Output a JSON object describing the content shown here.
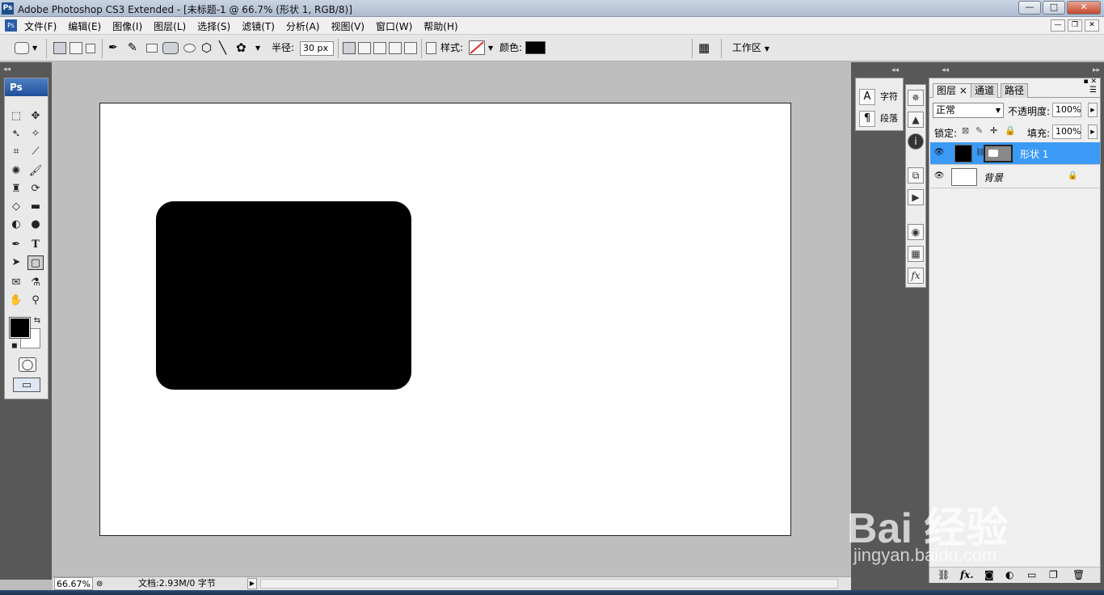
{
  "window": {
    "title": "Adobe Photoshop CS3 Extended - [未标题-1 @ 66.7% (形状 1, RGB/8)]",
    "app_icon_text": "Ps",
    "minimize": "—",
    "maximize": "□",
    "close": "✕"
  },
  "menu": {
    "items": [
      "文件(F)",
      "编辑(E)",
      "图像(I)",
      "图层(L)",
      "选择(S)",
      "滤镜(T)",
      "分析(A)",
      "视图(V)",
      "窗口(W)",
      "帮助(H)"
    ],
    "doc_minimize": "—",
    "doc_restore": "❐",
    "doc_close": "✕"
  },
  "options": {
    "radius_label": "半径:",
    "radius_value": "30 px",
    "style_label": "样式:",
    "color_label": "颜色:",
    "color_value": "#000000",
    "workspace_label": "工作区",
    "workspace_arrow": "▼"
  },
  "toolbox": {
    "header": "Ps",
    "foreground_color": "#000000",
    "background_color": "#ffffff"
  },
  "status": {
    "zoom": "66.67%",
    "doc_info": "文档:2.93M/0 字节",
    "arrow": "▶"
  },
  "mini_panel": {
    "char_label": "字符",
    "para_label": "段落",
    "char_icon": "A",
    "para_icon": "¶"
  },
  "layers_panel": {
    "tabs": [
      "图层",
      "通道",
      "路径"
    ],
    "tab_close": "×",
    "blend_mode": "正常",
    "opacity_label": "不透明度:",
    "opacity_value": "100%",
    "lock_label": "锁定:",
    "fill_label": "填充:",
    "fill_value": "100%",
    "layers": [
      {
        "name": "形状 1",
        "selected": true
      },
      {
        "name": "背景",
        "selected": false
      }
    ],
    "footer_fx": "fx."
  },
  "watermark": {
    "brand": "Bai 经验",
    "url": "jingyan.baidu.com"
  },
  "colors": {
    "selection_blue": "#3a9af5",
    "shape_fill": "#000000",
    "canvas": "#ffffff"
  }
}
